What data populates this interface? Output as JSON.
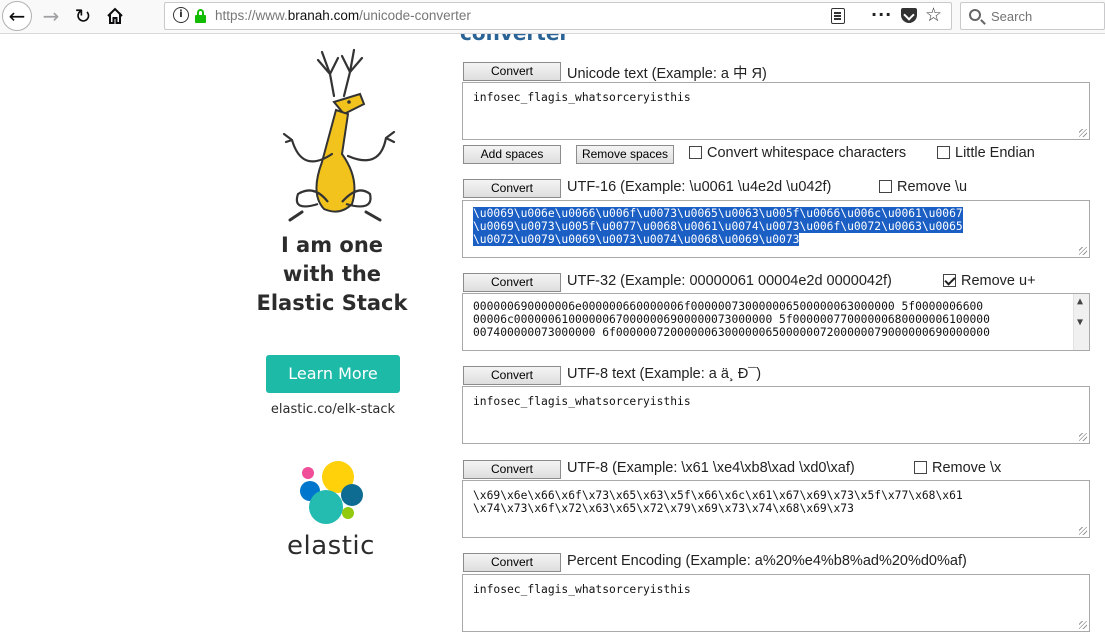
{
  "browser": {
    "url_scheme": "https://www.",
    "url_domain": "branah.com",
    "url_path": "/unicode-converter",
    "search_placeholder": "Search"
  },
  "ad": {
    "headline_line1": "I am one",
    "headline_line2": "with the",
    "headline_line3": "Elastic Stack",
    "cta": "Learn More",
    "link": "elastic.co/elk-stack",
    "brand": "elastic",
    "cta_color": "#1ebaa8"
  },
  "converter": {
    "heading_partial": "converter",
    "add_spaces": "Add spaces",
    "remove_spaces": "Remove spaces",
    "convert_whitespace_label": "Convert whitespace characters",
    "little_endian_label": "Little Endian",
    "sections": {
      "unicode": {
        "button": "Convert",
        "label": "Unicode text (Example: a 中 Я)",
        "value": "infosec_flagis_whatsorceryisthis"
      },
      "utf16": {
        "button": "Convert",
        "label": "UTF-16 (Example: \\u0061 \\u4e2d \\u042f)",
        "option": "Remove \\u",
        "option_checked": false,
        "line1": "\\u0069\\u006e\\u0066\\u006f\\u0073\\u0065\\u0063\\u005f\\u0066\\u006c\\u0061\\u0067",
        "line2": "\\u0069\\u0073\\u005f\\u0077\\u0068\\u0061\\u0074\\u0073\\u006f\\u0072\\u0063\\u0065",
        "line3": "\\u0072\\u0079\\u0069\\u0073\\u0074\\u0068\\u0069\\u0073"
      },
      "utf32": {
        "button": "Convert",
        "label": "UTF-32 (Example: 00000061 00004e2d 0000042f)",
        "option": "Remove u+",
        "option_checked": true,
        "line1": "000000690000006e000000660000006f000000730000006500000063000000 5f0000006600",
        "line2": "00006c00000061000000670000006900000073000000 5f00000077000000680000006100000",
        "line3": "007400000073000000 6f0000007200000063000000650000007200000079000000690000000"
      },
      "utf8text": {
        "button": "Convert",
        "label": "UTF-8 text (Example: a ä¸ Ð¯)",
        "value": "infosec_flagis_whatsorceryisthis"
      },
      "utf8": {
        "button": "Convert",
        "label": "UTF-8 (Example: \\x61 \\xe4\\xb8\\xad \\xd0\\xaf)",
        "option": "Remove \\x",
        "option_checked": false,
        "line1": "\\x69\\x6e\\x66\\x6f\\x73\\x65\\x63\\x5f\\x66\\x6c\\x61\\x67\\x69\\x73\\x5f\\x77\\x68\\x61",
        "line2": "\\x74\\x73\\x6f\\x72\\x63\\x65\\x72\\x79\\x69\\x73\\x74\\x68\\x69\\x73"
      },
      "percent": {
        "button": "Convert",
        "label": "Percent Encoding (Example: a%20%e4%b8%ad%20%d0%af)",
        "value": "infosec_flagis_whatsorceryisthis"
      }
    }
  }
}
